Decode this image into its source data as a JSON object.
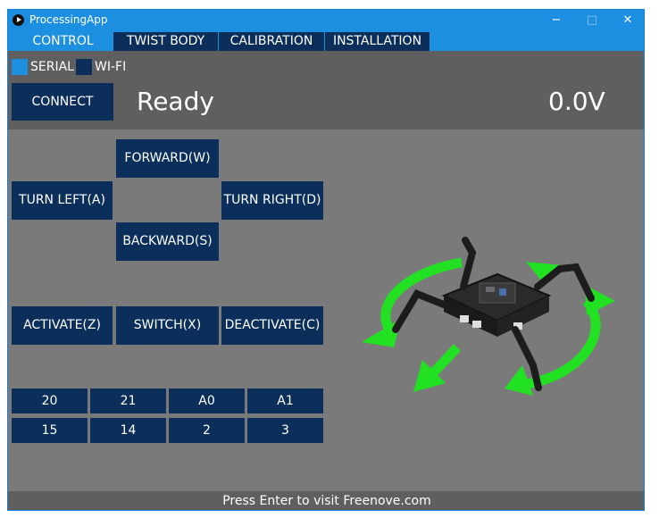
{
  "window": {
    "title": "ProcessingApp",
    "minimize": "−",
    "maximize": "□",
    "close": "✕"
  },
  "tabs": [
    {
      "label": "CONTROL",
      "active": true
    },
    {
      "label": "TWIST BODY",
      "active": false
    },
    {
      "label": "CALIBRATION",
      "active": false
    },
    {
      "label": "INSTALLATION",
      "active": false
    }
  ],
  "connection": {
    "serial_label": "SERIAL",
    "serial_selected": true,
    "wifi_label": "WI-FI",
    "wifi_selected": false,
    "connect_label": "CONNECT",
    "status": "Ready",
    "voltage": "0.0V"
  },
  "controls": {
    "forward": "FORWARD(W)",
    "turn_left": "TURN LEFT(A)",
    "turn_right": "TURN RIGHT(D)",
    "backward": "BACKWARD(S)",
    "activate": "ACTIVATE(Z)",
    "switch": "SWITCH(X)",
    "deactivate": "DEACTIVATE(C)"
  },
  "pins": {
    "row1": [
      "20",
      "21",
      "A0",
      "A1"
    ],
    "row2": [
      "15",
      "14",
      "2",
      "3"
    ]
  },
  "footer": {
    "text": "Press Enter to visit Freenove.com"
  },
  "colors": {
    "accent": "#1c8fe0",
    "button": "#0b2f5a",
    "background": "#7a7a7a",
    "panel": "#5f5f5f",
    "arrow": "#22e022"
  },
  "icons": {
    "app": "processing-logo-icon",
    "robot": "crawler-robot-icon"
  }
}
